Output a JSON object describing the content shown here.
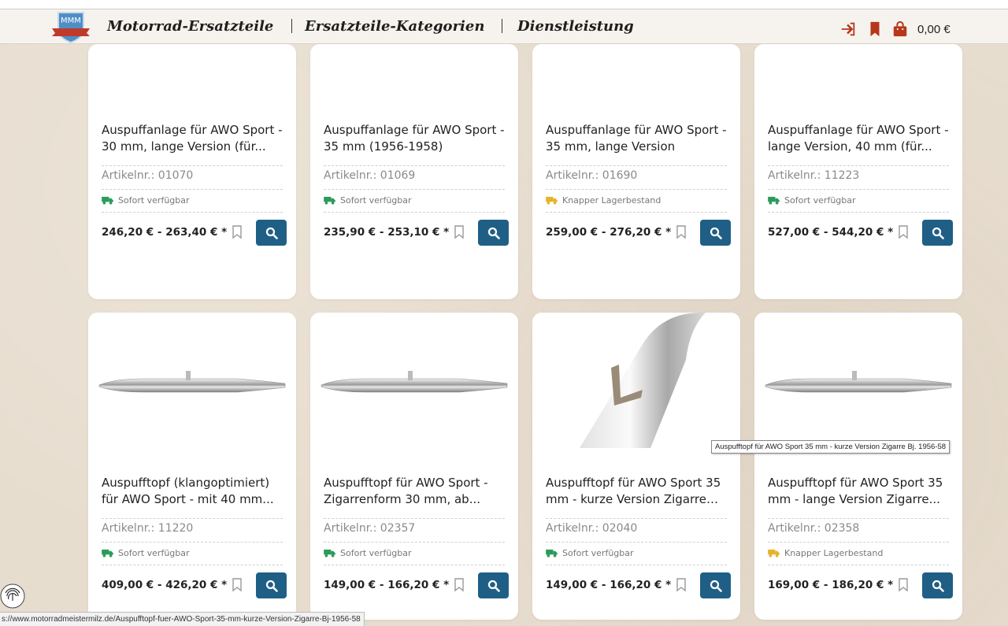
{
  "header": {
    "logo_text": "MMM",
    "nav": [
      {
        "label": "Motorrad-Ersatzteile"
      },
      {
        "label": "Ersatzteile-Kategorien"
      },
      {
        "label": "Dienstleistung"
      }
    ],
    "cart_total": "0,00 €",
    "accent_color": "#b7371b"
  },
  "products": [
    {
      "title": "Auspuffanlage für AWO Sport - 30 mm, lange Version (für...",
      "art_label": "Artikelnr.:",
      "art_no": "01070",
      "availability": "Sofort verfügbar",
      "avail_status": "green",
      "price": "246,20 € - 263,40 € *"
    },
    {
      "title": "Auspuffanlage für AWO Sport - 35 mm (1956-1958)",
      "art_label": "Artikelnr.:",
      "art_no": "01069",
      "availability": "Sofort verfügbar",
      "avail_status": "green",
      "price": "235,90 € - 253,10 € *"
    },
    {
      "title": "Auspuffanlage für AWO Sport - 35 mm, lange Version",
      "art_label": "Artikelnr.:",
      "art_no": "01690",
      "availability": "Knapper Lagerbestand",
      "avail_status": "yellow",
      "price": "259,00 € - 276,20 € *"
    },
    {
      "title": "Auspuffanlage für AWO Sport - lange Version, 40 mm (für...",
      "art_label": "Artikelnr.:",
      "art_no": "11223",
      "availability": "Sofort verfügbar",
      "avail_status": "green",
      "price": "527,00 € - 544,20 € *"
    },
    {
      "title": "Auspufftopf (klangoptimiert) für AWO Sport - mit 40 mm...",
      "art_label": "Artikelnr.:",
      "art_no": "11220",
      "availability": "Sofort verfügbar",
      "avail_status": "green",
      "price": "409,00 € - 426,20 € *"
    },
    {
      "title": "Auspufftopf für AWO Sport - Zigarrenform 30 mm, ab...",
      "art_label": "Artikelnr.:",
      "art_no": "02357",
      "availability": "Sofort verfügbar",
      "avail_status": "green",
      "price": "149,00 € - 166,20 € *"
    },
    {
      "title": "Auspufftopf für AWO Sport 35 mm - kurze Version Zigarre Bj....",
      "art_label": "Artikelnr.:",
      "art_no": "02040",
      "availability": "Sofort verfügbar",
      "avail_status": "green",
      "price": "149,00 € - 166,20 € *"
    },
    {
      "title": "Auspufftopf für AWO Sport 35 mm - lange Version Zigarre...",
      "art_label": "Artikelnr.:",
      "art_no": "02358",
      "availability": "Knapper Lagerbestand",
      "avail_status": "yellow",
      "price": "169,00 € - 186,20 € *"
    }
  ],
  "tooltip": "Auspufftopf für AWO Sport 35 mm - kurze Version Zigarre Bj. 1956-58",
  "status_url": "s://www.motorradmeistermilz.de/Auspufftopf-fuer-AWO-Sport-35-mm-kurze-Version-Zigarre-Bj-1956-58",
  "colors": {
    "button": "#1f5f85",
    "green": "#2a9b5a",
    "yellow": "#e6b32a"
  }
}
